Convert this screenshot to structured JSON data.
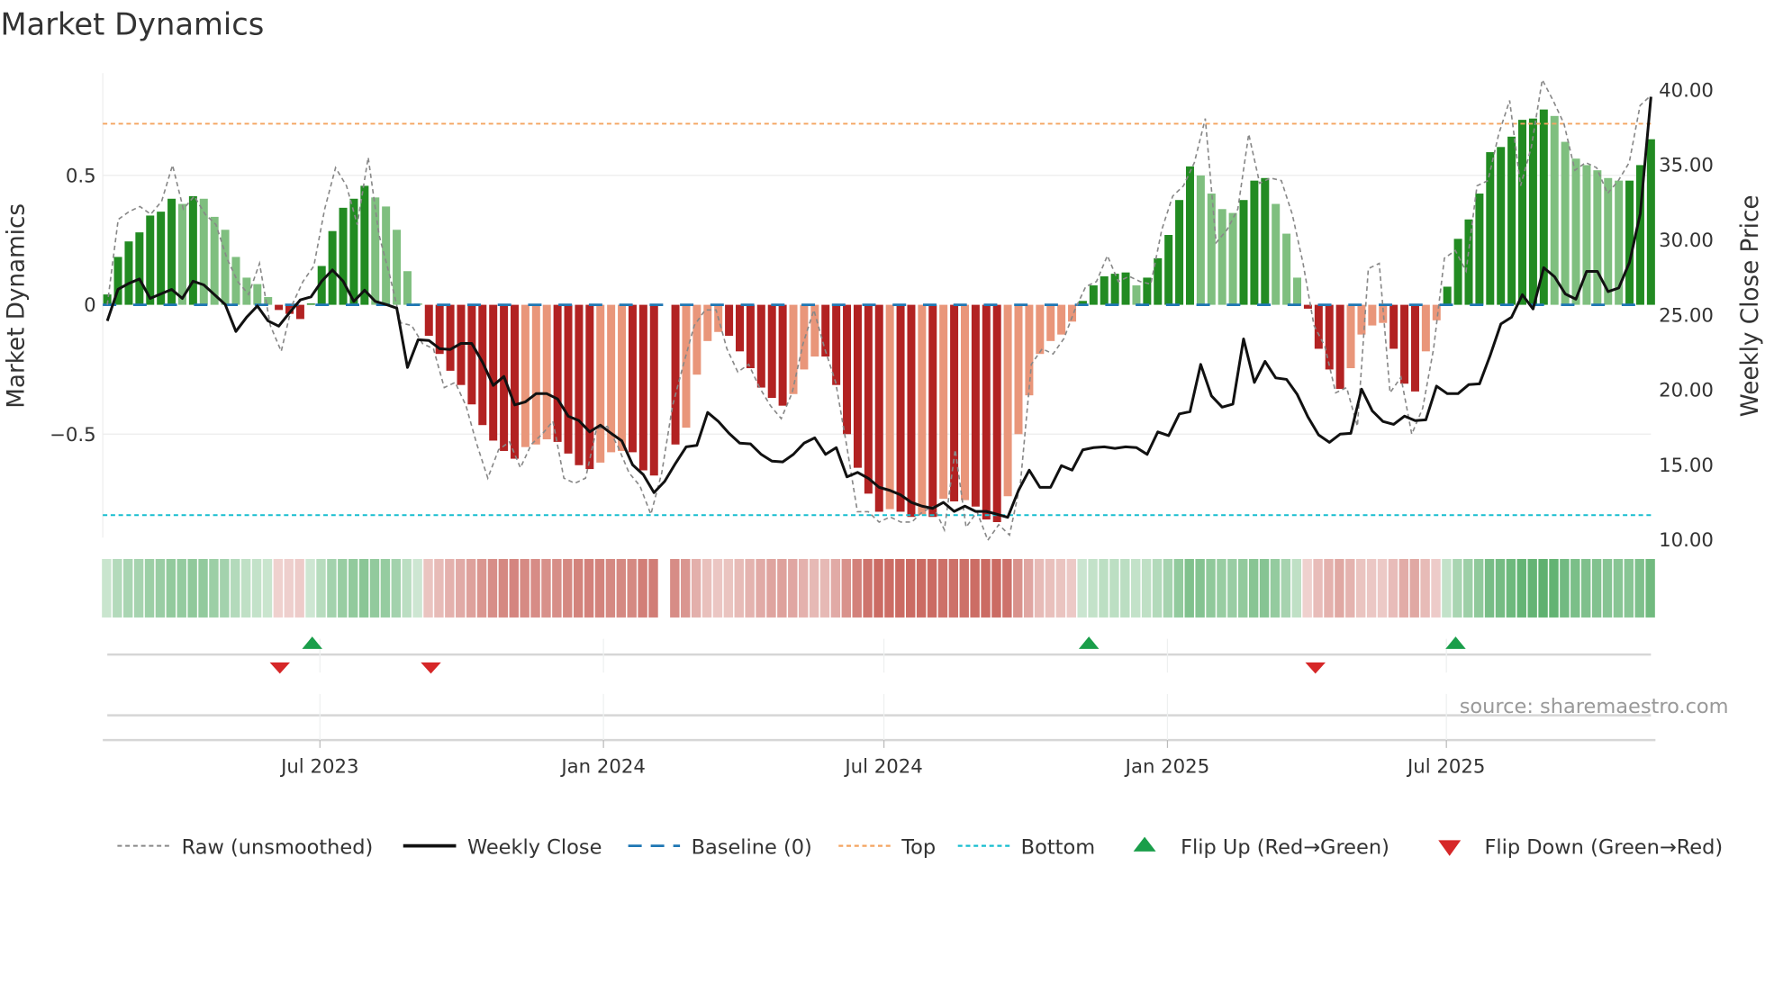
{
  "chart_data": {
    "type": "bar",
    "title": "Market Dynamics",
    "ylabel_left": "Market Dynamics",
    "ylabel_right": "Weekly Close Price",
    "source": "source: sharemaestro.com",
    "first_week": "2023-02-13",
    "left_ticks": [
      {
        "v": 0.5,
        "label": "0.5"
      },
      {
        "v": 0,
        "label": "0"
      },
      {
        "v": -0.5,
        "label": "−0.5"
      }
    ],
    "right_ticks": [
      {
        "v": 40,
        "label": "40.00"
      },
      {
        "v": 35,
        "label": "35.00"
      },
      {
        "v": 30,
        "label": "30.00"
      },
      {
        "v": 25,
        "label": "25.00"
      },
      {
        "v": 20,
        "label": "20.00"
      },
      {
        "v": 15,
        "label": "15.00"
      },
      {
        "v": 10,
        "label": "10.00"
      }
    ],
    "x_ticks": [
      {
        "date": "2023-07-01",
        "label": "Jul 2023"
      },
      {
        "date": "2024-01-01",
        "label": "Jan 2024"
      },
      {
        "date": "2024-07-01",
        "label": "Jul 2024"
      },
      {
        "date": "2025-01-01",
        "label": "Jan 2025"
      },
      {
        "date": "2025-07-01",
        "label": "Jul 2025"
      }
    ],
    "top_level": 0.7,
    "bottom_level": -0.813,
    "baseline": 0,
    "dynamics": [
      0.04,
      0.185,
      0.245,
      0.28,
      0.345,
      0.36,
      0.41,
      0.39,
      0.42,
      0.41,
      0.34,
      0.29,
      0.185,
      0.105,
      0.08,
      0.03,
      -0.02,
      -0.035,
      -0.055,
      0.005,
      0.15,
      0.285,
      0.375,
      0.41,
      0.46,
      0.415,
      0.38,
      0.29,
      0.13,
      0.005,
      -0.12,
      -0.19,
      -0.255,
      -0.31,
      -0.385,
      -0.465,
      -0.525,
      -0.565,
      -0.595,
      -0.55,
      -0.54,
      -0.52,
      -0.53,
      -0.575,
      -0.62,
      -0.635,
      -0.61,
      -0.57,
      -0.565,
      -0.57,
      -0.64,
      -0.66,
      null,
      -0.54,
      -0.475,
      -0.27,
      -0.14,
      -0.105,
      -0.12,
      -0.18,
      -0.245,
      -0.32,
      -0.36,
      -0.39,
      -0.345,
      -0.25,
      -0.2,
      -0.2,
      -0.31,
      -0.5,
      -0.63,
      -0.73,
      -0.8,
      -0.79,
      -0.8,
      -0.82,
      -0.81,
      -0.82,
      -0.75,
      -0.76,
      -0.755,
      -0.78,
      -0.83,
      -0.84,
      -0.74,
      -0.5,
      -0.35,
      -0.19,
      -0.14,
      -0.115,
      -0.065,
      0.015,
      0.075,
      0.11,
      0.12,
      0.125,
      0.075,
      0.105,
      0.18,
      0.27,
      0.405,
      0.535,
      0.5,
      0.43,
      0.37,
      0.355,
      0.405,
      0.48,
      0.49,
      0.39,
      0.275,
      0.105,
      -0.015,
      -0.17,
      -0.25,
      -0.325,
      -0.245,
      -0.115,
      -0.08,
      -0.07,
      -0.17,
      -0.305,
      -0.335,
      -0.18,
      -0.06,
      0.07,
      0.255,
      0.33,
      0.43,
      0.59,
      0.61,
      0.65,
      0.715,
      0.72,
      0.755,
      0.73,
      0.63,
      0.565,
      0.54,
      0.52,
      0.49,
      0.48,
      0.48,
      0.54,
      0.64
    ],
    "raw": [
      0.0,
      0.33,
      0.36,
      0.38,
      0.35,
      0.4,
      0.54,
      0.37,
      0.42,
      0.35,
      0.31,
      0.18,
      0.09,
      0.04,
      0.16,
      -0.08,
      -0.18,
      0.0,
      0.09,
      0.15,
      0.37,
      0.53,
      0.46,
      0.31,
      0.57,
      0.27,
      0.11,
      -0.07,
      -0.08,
      -0.15,
      -0.17,
      -0.32,
      -0.3,
      -0.39,
      -0.54,
      -0.67,
      -0.56,
      -0.53,
      -0.63,
      -0.54,
      -0.5,
      -0.45,
      -0.67,
      -0.69,
      -0.67,
      -0.48,
      -0.47,
      -0.55,
      -0.65,
      -0.7,
      -0.81,
      -0.65,
      -0.39,
      -0.23,
      -0.08,
      -0.02,
      -0.02,
      -0.17,
      -0.26,
      -0.23,
      -0.32,
      -0.39,
      -0.44,
      -0.34,
      -0.15,
      -0.02,
      -0.17,
      -0.3,
      -0.54,
      -0.8,
      -0.8,
      -0.84,
      -0.82,
      -0.84,
      -0.84,
      -0.8,
      -0.78,
      -0.87,
      -0.56,
      -0.86,
      -0.8,
      -0.91,
      -0.85,
      -0.89,
      -0.69,
      -0.23,
      -0.17,
      -0.19,
      -0.13,
      -0.02,
      0.07,
      0.09,
      0.19,
      0.09,
      0.11,
      0.09,
      0.08,
      0.29,
      0.42,
      0.46,
      0.55,
      0.72,
      0.24,
      0.29,
      0.37,
      0.66,
      0.47,
      0.49,
      0.48,
      0.35,
      0.16,
      -0.08,
      -0.16,
      -0.34,
      -0.32,
      -0.47,
      0.14,
      0.16,
      -0.34,
      -0.28,
      -0.5,
      -0.4,
      -0.17,
      0.18,
      0.21,
      0.13,
      0.46,
      0.48,
      0.66,
      0.79,
      0.46,
      0.61,
      0.87,
      0.79,
      0.7,
      0.52,
      0.55,
      0.53,
      0.43,
      0.48,
      0.55,
      0.77,
      0.81
    ],
    "weekly_close": [
      24.6,
      26.7,
      27.1,
      27.4,
      26.1,
      26.4,
      26.7,
      26.1,
      27.25,
      27.0,
      26.35,
      25.7,
      23.9,
      24.85,
      25.6,
      24.6,
      24.25,
      25.15,
      26.0,
      26.2,
      27.25,
      28.0,
      27.25,
      25.9,
      26.65,
      25.9,
      25.7,
      25.45,
      21.5,
      23.35,
      23.3,
      22.75,
      22.7,
      23.1,
      23.1,
      21.85,
      20.3,
      20.9,
      19.0,
      19.2,
      19.75,
      19.75,
      19.4,
      18.25,
      17.95,
      17.2,
      17.65,
      17.1,
      16.6,
      15.0,
      14.35,
      13.15,
      13.9,
      15.1,
      16.2,
      16.3,
      18.5,
      17.9,
      17.1,
      16.45,
      16.4,
      15.7,
      15.25,
      15.2,
      15.7,
      16.45,
      16.8,
      15.7,
      16.15,
      14.2,
      14.5,
      14.1,
      13.5,
      13.3,
      13.0,
      12.5,
      12.25,
      12.1,
      12.5,
      11.9,
      12.25,
      11.9,
      11.9,
      11.7,
      11.5,
      13.3,
      14.65,
      13.5,
      13.5,
      14.95,
      14.65,
      16.0,
      16.15,
      16.2,
      16.1,
      16.2,
      16.15,
      15.7,
      17.2,
      16.95,
      18.4,
      18.55,
      21.7,
      19.6,
      18.85,
      19.05,
      23.4,
      20.5,
      21.9,
      20.8,
      20.7,
      19.7,
      18.2,
      17.0,
      16.5,
      17.05,
      17.1,
      20.05,
      18.6,
      17.9,
      17.7,
      18.25,
      17.95,
      18.0,
      20.25,
      19.75,
      19.75,
      20.35,
      20.4,
      22.3,
      24.4,
      24.85,
      26.35,
      25.4,
      28.15,
      27.55,
      26.4,
      26.05,
      27.9,
      27.9,
      26.55,
      26.8,
      28.5,
      31.75,
      39.55
    ],
    "flips_up": [
      "2023-06-26",
      "2024-11-11",
      "2025-07-07"
    ],
    "flips_down": [
      "2023-06-05",
      "2023-09-11",
      "2025-04-07"
    ],
    "colors": {
      "green_dark": "#228b22",
      "green_light": "#7fbf7f",
      "red_dark": "#b22222",
      "red_light": "#e9967a",
      "raw": "#888888",
      "close": "#111111",
      "baseline": "#1f77b4",
      "top": "#f4a460",
      "bottom": "#17becf",
      "flip_up": "#1a9e4a",
      "flip_down": "#d62728"
    },
    "legend": [
      {
        "label": "Raw (unsmoothed)"
      },
      {
        "label": "Weekly Close"
      },
      {
        "label": "Baseline (0)"
      },
      {
        "label": "Top"
      },
      {
        "label": "Bottom"
      },
      {
        "label": "Flip Up (Red→Green)"
      },
      {
        "label": "Flip Down (Green→Red)"
      }
    ]
  }
}
